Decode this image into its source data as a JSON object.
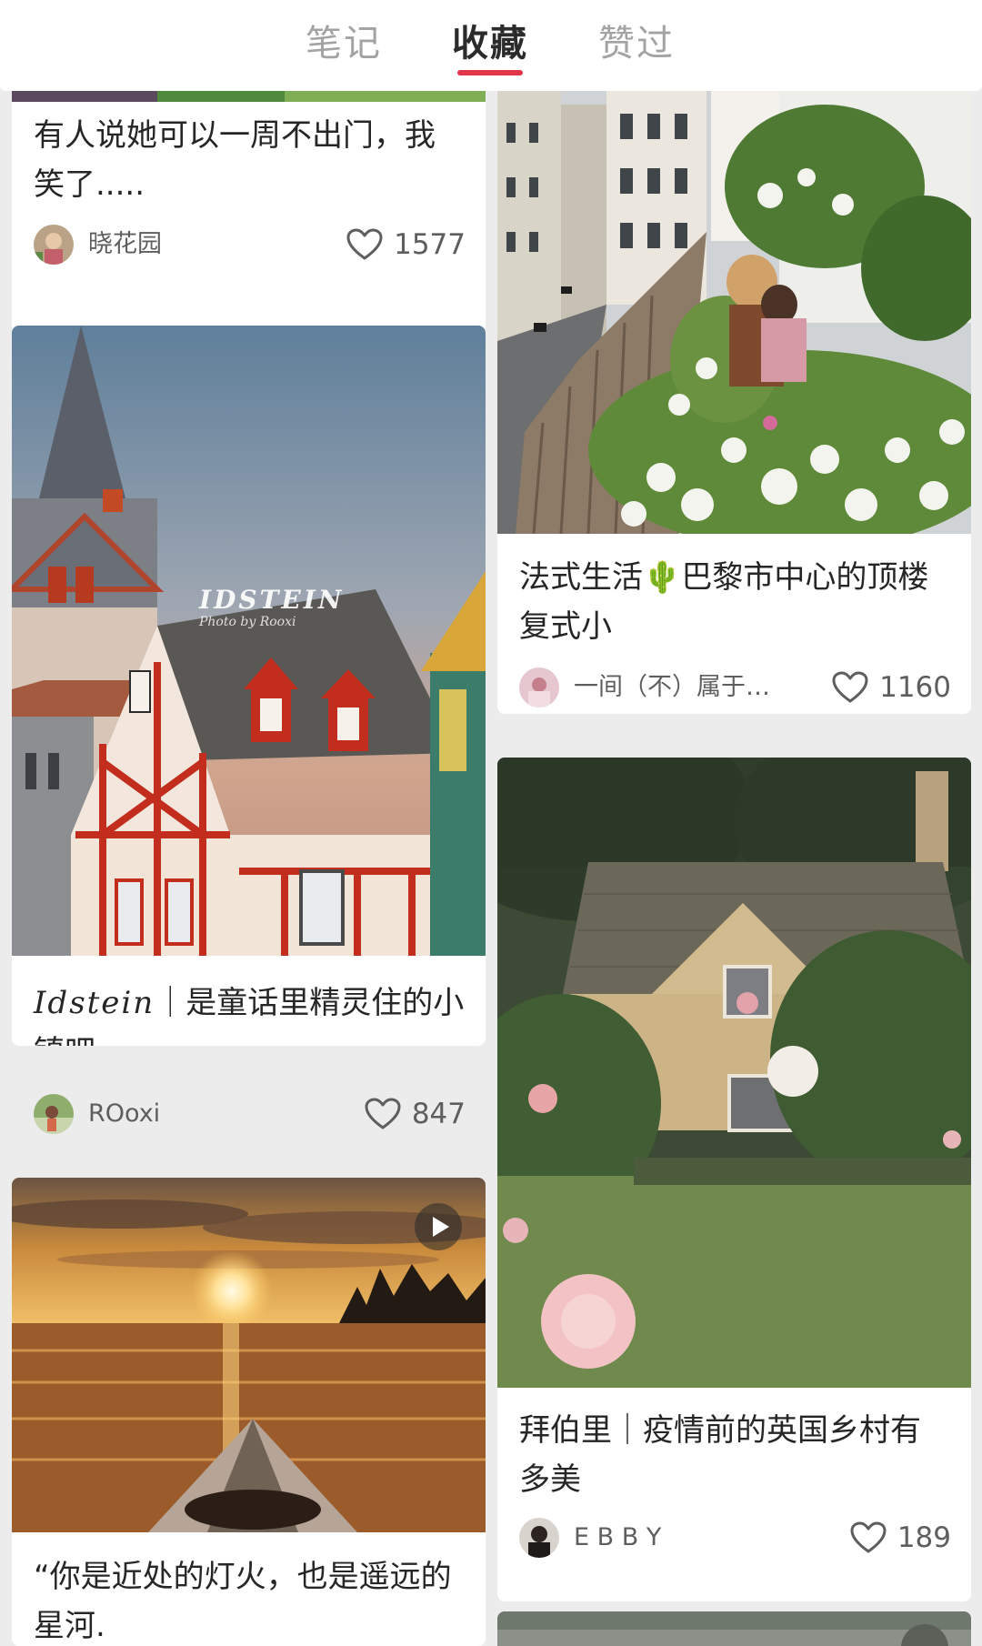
{
  "tabs": [
    {
      "label": "笔记",
      "active": false
    },
    {
      "label": "收藏",
      "active": true
    },
    {
      "label": "赞过",
      "active": false
    }
  ],
  "accent_color": "#e0354a",
  "notes": {
    "left": [
      {
        "title": "有人说她可以一周不出门，我笑了.....",
        "author": "晓花园",
        "likes": "1577",
        "cover_icon": "garden-photo"
      },
      {
        "title_latin": "Idstein",
        "title": "｜是童话里精灵住的小镇吧",
        "author": "ROoxi",
        "likes": "847",
        "cover_watermark": "IDSTEIN",
        "cover_watermark_sub": "Photo by Rooxi",
        "cover_icon": "half-timbered-town-photo"
      },
      {
        "title": "“你是近处的灯火，也是遥远的星河.",
        "is_video": true,
        "cover_icon": "sunset-kayak-photo"
      }
    ],
    "right": [
      {
        "title": "法式生活🌵巴黎市中心的顶楼复式小",
        "author": "一间（不）属于…",
        "likes": "1160",
        "cover_icon": "paris-rooftop-terrace-photo"
      },
      {
        "title": "拜伯里｜疫情前的英国乡村有多美",
        "author": "E B B Y",
        "likes": "189",
        "cover_icon": "english-cottage-photo"
      }
    ]
  }
}
